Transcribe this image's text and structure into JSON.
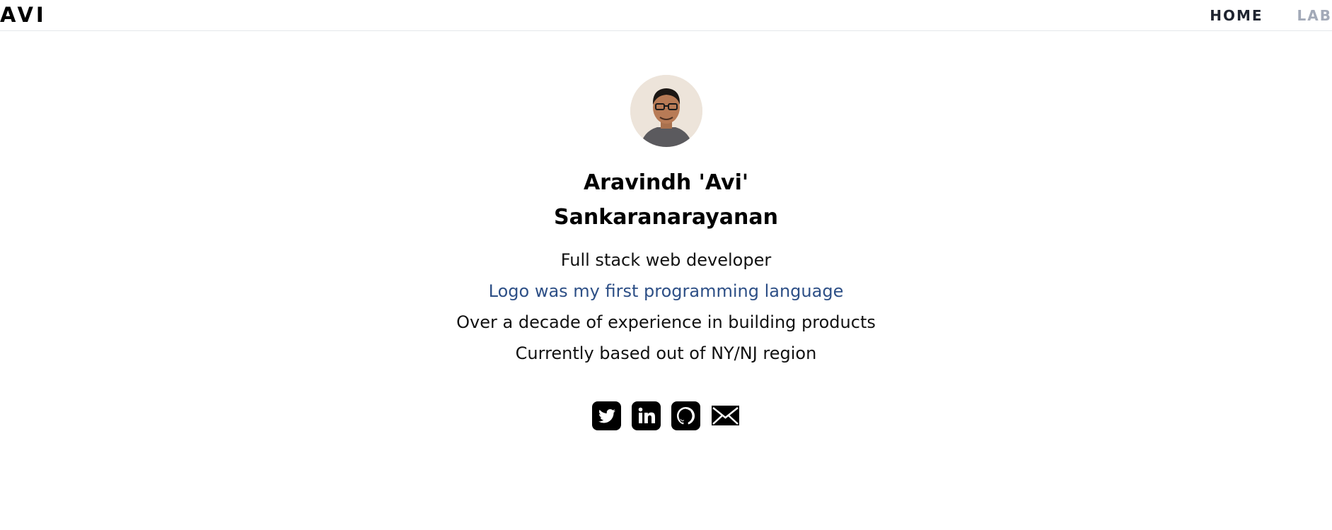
{
  "header": {
    "brand": "AVI",
    "nav": [
      {
        "label": "HOME"
      },
      {
        "label": "LAB"
      }
    ]
  },
  "profile": {
    "name_line1": "Aravindh 'Avi'",
    "name_line2": "Sankaranarayanan",
    "tagline": "Full stack web developer",
    "first_language": "Logo was my first programming language",
    "experience": "Over a decade of experience in building products",
    "location": "Currently based out of NY/NJ region"
  },
  "socials": [
    {
      "icon": "twitter-icon"
    },
    {
      "icon": "linkedin-icon"
    },
    {
      "icon": "github-icon"
    },
    {
      "icon": "mail-icon"
    }
  ],
  "colors": {
    "link": "#2d4f86",
    "nav_active": "#1f2430",
    "nav_inactive": "#a3aab8"
  }
}
